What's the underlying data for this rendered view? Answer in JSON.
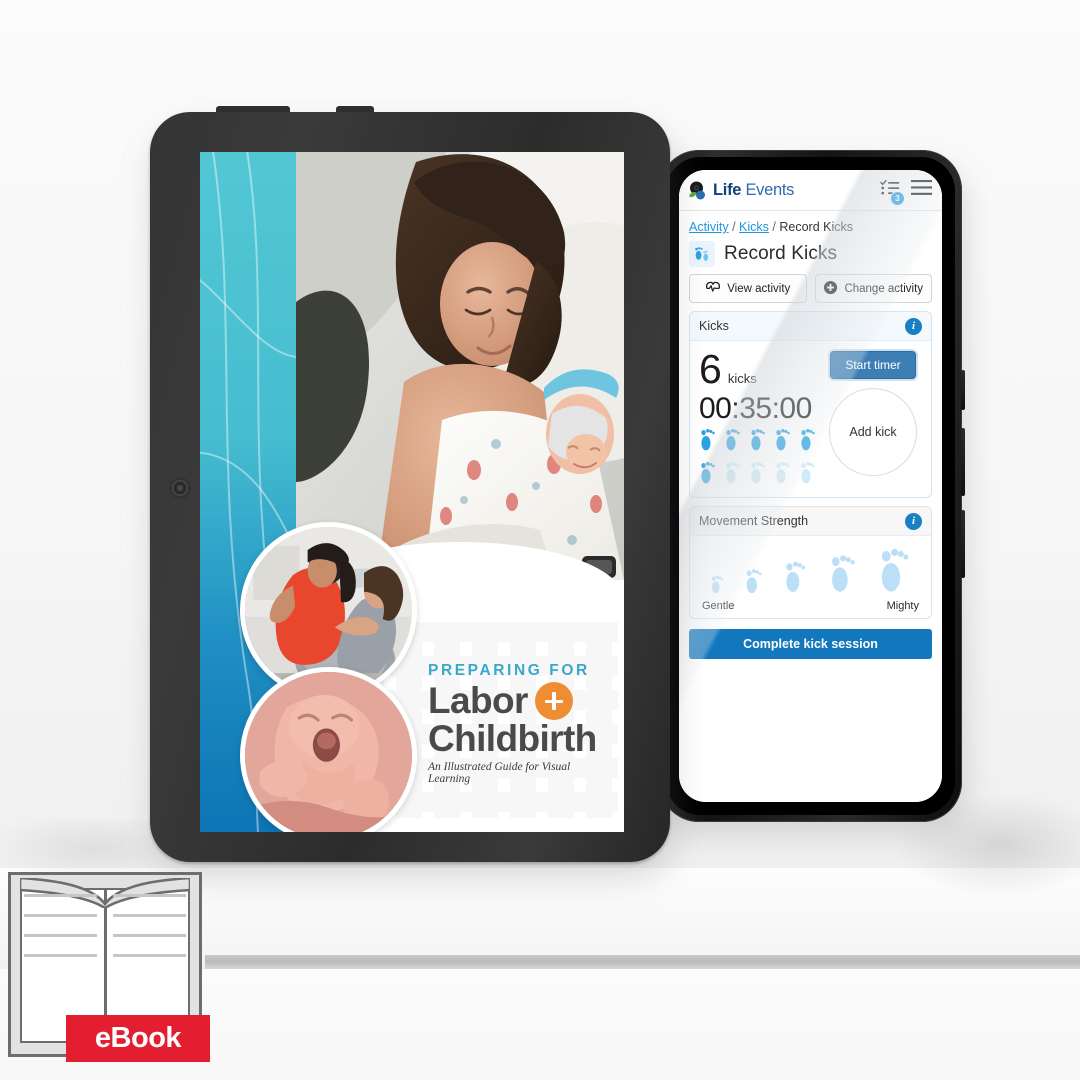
{
  "badge": {
    "label": "eBook",
    "icon": "open-book-icon"
  },
  "ebook_cover": {
    "preheading": "PREPARING FOR",
    "title_line1": "Labor",
    "title_line2": "Childbirth",
    "plus_icon": "plus-circle-icon",
    "subtitle": "An Illustrated Guide for Visual Learning",
    "hero_alt": "mother-holding-newborn-photo",
    "inset1_alt": "pregnant-woman-birth-ball-photo",
    "inset2_alt": "crying-newborn-photo",
    "accent_teal": "#46bdd0",
    "accent_blue": "#0d74b5",
    "accent_orange": "#ef8d34",
    "pre_color": "#3aa9c9"
  },
  "phone_app": {
    "header": {
      "logo_bold": "Life",
      "logo_light": "Events",
      "logo_mark_icon": "life-events-logo-icon",
      "tasks_icon": "checklist-icon",
      "tasks_badge": "3",
      "menu_icon": "hamburger-menu-icon"
    },
    "breadcrumb": {
      "item1": "Activity",
      "sep1": "/",
      "item2": "Kicks",
      "sep2": "/",
      "current": "Record Kicks"
    },
    "page_title": {
      "text": "Record Kicks",
      "icon": "baby-footprints-icon"
    },
    "actions": [
      {
        "label": "View activity",
        "icon": "activity-pulse-icon"
      },
      {
        "label": "Change activity",
        "icon": "plus-circle-filled-icon"
      }
    ],
    "kicks_card": {
      "title": "Kicks",
      "info_icon": "info-icon",
      "count": "6",
      "count_label": "kicks",
      "timer": "00:35:00",
      "start_button": "Start timer",
      "add_button": "Add kick",
      "footprints_total": 10,
      "footprints_filled": 6
    },
    "movement_card": {
      "title": "Movement Strength",
      "info_icon": "info-icon",
      "low_label": "Gentle",
      "high_label": "Mighty",
      "steps": 5
    },
    "cta": "Complete kick session",
    "colors": {
      "primary_blue": "#1277bd",
      "link_blue": "#2196e0",
      "footprint_blue": "#29a3e3",
      "timer_button": "#3d7fb5"
    }
  }
}
